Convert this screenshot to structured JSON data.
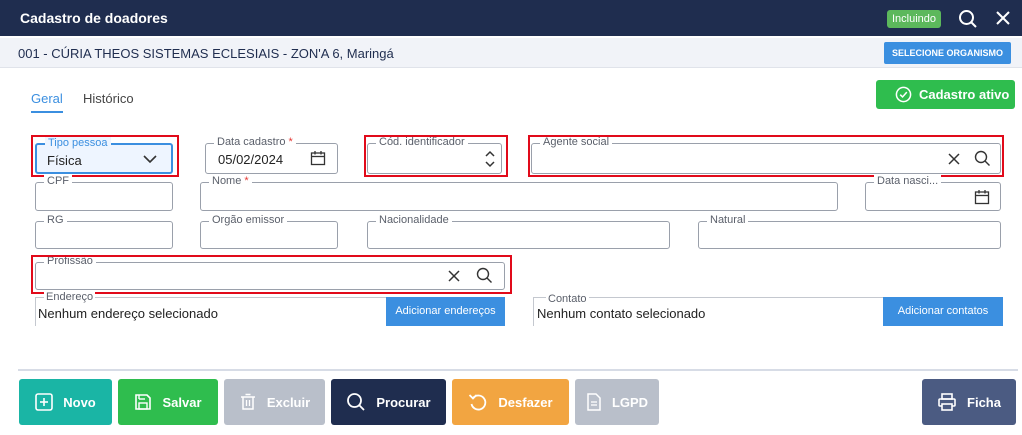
{
  "window": {
    "title": "Cadastro de doadores",
    "mode_badge": "Incluindo"
  },
  "organization": {
    "label": "001 - CÚRIA THEOS SISTEMAS ECLESIAIS - ZON'A 6, Maringá",
    "select_button": "SELECIONE ORGANISMO"
  },
  "tabs": [
    {
      "label": "Geral",
      "active": true
    },
    {
      "label": "Histórico",
      "active": false
    }
  ],
  "status_button": "Cadastro ativo",
  "form": {
    "tipo_pessoa": {
      "label": "Tipo pessoa",
      "value": "Física"
    },
    "data_cadastro": {
      "label": "Data cadastro",
      "required": "*",
      "value": "05/02/2024"
    },
    "cod_identificador": {
      "label": "Cód. identificador",
      "value": ""
    },
    "agente_social": {
      "label": "Agente social",
      "value": ""
    },
    "cpf": {
      "label": "CPF",
      "value": ""
    },
    "nome": {
      "label": "Nome",
      "required": "*",
      "value": ""
    },
    "data_nascimento": {
      "label": "Data nasci...",
      "value": ""
    },
    "rg": {
      "label": "RG",
      "value": ""
    },
    "orgao_emissor": {
      "label": "Orgão emissor",
      "value": ""
    },
    "nacionalidade": {
      "label": "Nacionalidade",
      "value": ""
    },
    "natural": {
      "label": "Natural",
      "value": ""
    },
    "profissao": {
      "label": "Profissão",
      "value": ""
    },
    "endereco": {
      "label": "Endereço",
      "value": "Nenhum endereço selecionado",
      "button": "Adicionar endereços"
    },
    "contato": {
      "label": "Contato",
      "value": "Nenhum contato selecionado",
      "button": "Adicionar contatos"
    }
  },
  "actions": {
    "novo": "Novo",
    "salvar": "Salvar",
    "excluir": "Excluir",
    "procurar": "Procurar",
    "desfazer": "Desfazer",
    "lgpd": "LGPD",
    "ficha": "Ficha"
  },
  "colors": {
    "header": "#1f2d4f",
    "accent": "#3b8fe0",
    "success": "#2fbd4e",
    "highlight": "#e10a1a",
    "teal": "#1ab5a5",
    "green": "#2fbd4e",
    "gray": "#b9bfca",
    "navy": "#1f2d4f",
    "orange": "#f2a541",
    "slate": "#4b5b82"
  }
}
